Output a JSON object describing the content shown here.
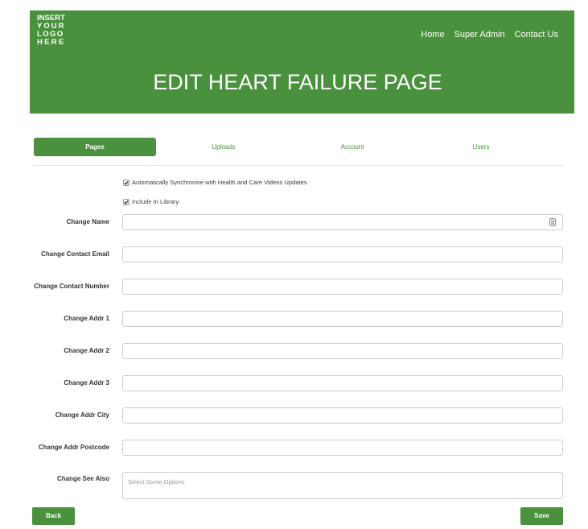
{
  "logo": {
    "lines": [
      "INSERT",
      "YOUR",
      "LOGO",
      "HERE"
    ]
  },
  "nav": {
    "items": [
      {
        "label": "Home"
      },
      {
        "label": "Super Admin"
      },
      {
        "label": "Contact Us"
      }
    ]
  },
  "page_title": "EDIT HEART FAILURE PAGE",
  "tabs": [
    {
      "label": "Pages",
      "active": true
    },
    {
      "label": "Uploads",
      "active": false
    },
    {
      "label": "Account",
      "active": false
    },
    {
      "label": "Users",
      "active": false
    }
  ],
  "options": [
    {
      "label": "Automatically Synchronise with Health and Care Videos Updates",
      "checked": true
    },
    {
      "label": "Include In Library",
      "checked": true
    }
  ],
  "form": {
    "fields": [
      {
        "label": "Change Name",
        "value": "",
        "icon": "contacts-autofill-icon"
      },
      {
        "label": "Change Contact Email",
        "value": ""
      },
      {
        "label": "Change Contact Number",
        "value": ""
      },
      {
        "label": "Change Addr 1",
        "value": ""
      },
      {
        "label": "Change Addr 2",
        "value": ""
      },
      {
        "label": "Change Addr 3",
        "value": ""
      },
      {
        "label": "Change Addr City",
        "value": ""
      },
      {
        "label": "Change Addr Postcode",
        "value": ""
      }
    ]
  },
  "see_also": {
    "label": "Change See Also",
    "placeholder": "Select Some Options"
  },
  "actions": {
    "back_label": "Back",
    "save_label": "Save"
  },
  "colors": {
    "brand_green": "#4a913e",
    "tab_text": "#4a913c",
    "input_border": "#cccccc",
    "placeholder": "#9a9a9a"
  }
}
